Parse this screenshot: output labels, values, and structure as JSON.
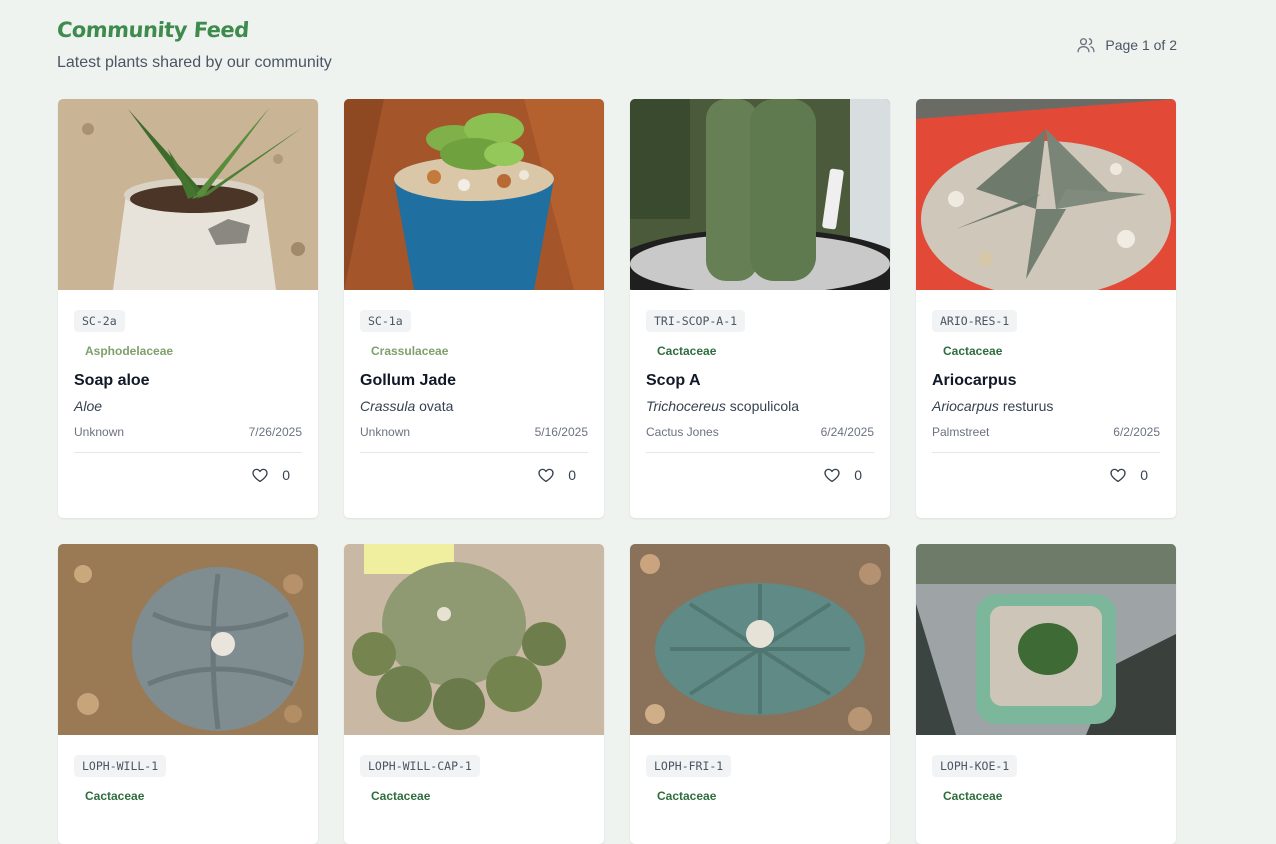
{
  "header": {
    "title": "Community Feed",
    "subtitle": "Latest plants shared by our community",
    "pagination": "Page 1 of 2",
    "pagination_icon": "users-icon"
  },
  "colors": {
    "background": "#eff3f0",
    "title": "#3f8b4e",
    "family_green": "#2f6d3e",
    "family_olive": "#7ea06b"
  },
  "cards": [
    {
      "code": "SC-2a",
      "family": "Asphodelaceae",
      "family_style": "olive",
      "name": "Soap aloe",
      "genus": "Aloe",
      "species": "",
      "owner": "Unknown",
      "date": "7/26/2025",
      "likes": "0",
      "photo": "aloe"
    },
    {
      "code": "SC-1a",
      "family": "Crassulaceae",
      "family_style": "olive",
      "name": "Gollum Jade",
      "genus": "Crassula",
      "species": "ovata",
      "owner": "Unknown",
      "date": "5/16/2025",
      "likes": "0",
      "photo": "jade"
    },
    {
      "code": "TRI-SCOP-A-1",
      "family": "Cactaceae",
      "family_style": "green",
      "name": "Scop A",
      "genus": "Trichocereus",
      "species": "scopulicola",
      "owner": "Cactus Jones",
      "date": "6/24/2025",
      "likes": "0",
      "photo": "column"
    },
    {
      "code": "ARIO-RES-1",
      "family": "Cactaceae",
      "family_style": "green",
      "name": "Ariocarpus",
      "genus": "Ariocarpus",
      "species": "resturus",
      "owner": "Palmstreet",
      "date": "6/2/2025",
      "likes": "0",
      "photo": "ario"
    },
    {
      "code": "LOPH-WILL-1",
      "family": "Cactaceae",
      "family_style": "green",
      "name": "",
      "genus": "",
      "species": "",
      "owner": "",
      "date": "",
      "likes": "",
      "photo": "loph-blue"
    },
    {
      "code": "LOPH-WILL-CAP-1",
      "family": "Cactaceae",
      "family_style": "green",
      "name": "",
      "genus": "",
      "species": "",
      "owner": "",
      "date": "",
      "likes": "",
      "photo": "loph-cluster"
    },
    {
      "code": "LOPH-FRI-1",
      "family": "Cactaceae",
      "family_style": "green",
      "name": "",
      "genus": "",
      "species": "",
      "owner": "",
      "date": "",
      "likes": "",
      "photo": "loph-teal"
    },
    {
      "code": "LOPH-KOE-1",
      "family": "Cactaceae",
      "family_style": "green",
      "name": "",
      "genus": "",
      "species": "",
      "owner": "",
      "date": "",
      "likes": "",
      "photo": "loph-pot"
    }
  ]
}
